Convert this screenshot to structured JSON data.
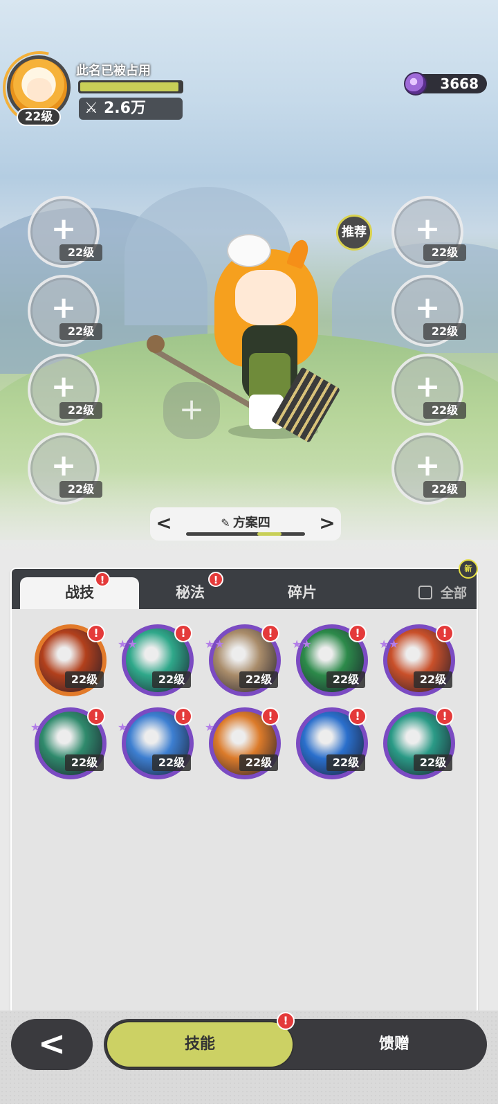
{
  "profile": {
    "name": "此名已被占用",
    "level": "22级",
    "exp_fraction": 0.97,
    "power": "2.6万",
    "power_icon": "crossed-swords-icon"
  },
  "currency": {
    "amount": "3668",
    "icon": "purple-gem-icon"
  },
  "left_slots": [
    {
      "plus": "+",
      "level": "22级"
    },
    {
      "plus": "+",
      "level": "22级"
    },
    {
      "plus": "+",
      "level": "22级"
    },
    {
      "plus": "+",
      "level": "22级"
    }
  ],
  "right_slots": [
    {
      "plus": "+",
      "level": "22级"
    },
    {
      "plus": "+",
      "level": "22级"
    },
    {
      "plus": "+",
      "level": "22级"
    },
    {
      "plus": "+",
      "level": "22级"
    }
  ],
  "recommend_label": "推荐",
  "pet_slot": {
    "plus": "+"
  },
  "plan": {
    "prev": "<",
    "next": ">",
    "label": "方案四",
    "edit_icon": "pencil-icon",
    "total": 5,
    "current": 4
  },
  "tabs": [
    {
      "label": "战技",
      "badge": "!",
      "active": true
    },
    {
      "label": "秘法",
      "badge": "!",
      "active": false
    },
    {
      "label": "碎片",
      "badge": "",
      "active": false
    }
  ],
  "filter": {
    "label": "全部",
    "checked": false
  },
  "new_badge": "新",
  "skills": [
    {
      "level": "22级",
      "badge": "!",
      "stars": "",
      "frame": "orange",
      "theme": "#b2401c"
    },
    {
      "level": "22级",
      "badge": "!",
      "stars": "★★",
      "frame": "purple",
      "theme": "#2fa88a"
    },
    {
      "level": "22级",
      "badge": "!",
      "stars": "★★",
      "frame": "purple",
      "theme": "#a98c6a"
    },
    {
      "level": "22级",
      "badge": "!",
      "stars": "★★",
      "frame": "purple",
      "theme": "#2c8a4a"
    },
    {
      "level": "22级",
      "badge": "!",
      "stars": "★★",
      "frame": "purple",
      "theme": "#c9502a"
    },
    {
      "level": "22级",
      "badge": "!",
      "stars": "★",
      "frame": "purple",
      "theme": "#2f8a6c"
    },
    {
      "level": "22级",
      "badge": "!",
      "stars": "★",
      "frame": "purple",
      "theme": "#3d7fd1"
    },
    {
      "level": "22级",
      "badge": "!",
      "stars": "★",
      "frame": "purple",
      "theme": "#dc7b2a"
    },
    {
      "level": "22级",
      "badge": "!",
      "stars": "",
      "frame": "purple",
      "theme": "#2a6fcc"
    },
    {
      "level": "22级",
      "badge": "!",
      "stars": "",
      "frame": "purple",
      "theme": "#2a9a86"
    }
  ],
  "bottom": {
    "back": "<",
    "skills_label": "技能",
    "skills_badge": "!",
    "gift_label": "馈赠"
  },
  "colors": {
    "accent": "#ccd164",
    "badge": "#e43a3a",
    "panel_header": "#3b3e43",
    "rare_frame": "#7b4bc2"
  }
}
